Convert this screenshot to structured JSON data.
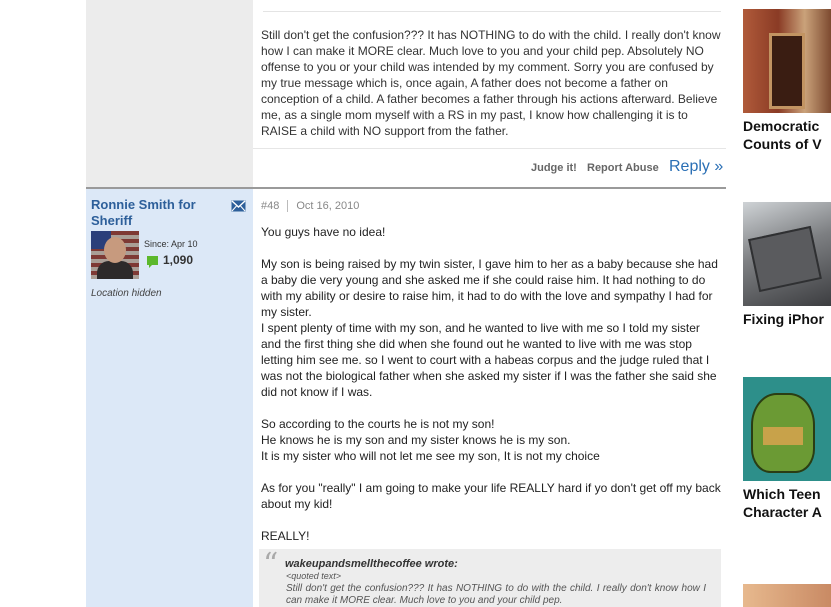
{
  "prev_post": {
    "body": "Still don't get the confusion??? It has NOTHING to do with the child. I really don't know how I can make it MORE clear. Much love to you and your child pep. Absolutely NO offense to you or your child was intended by my comment. Sorry you are confused by my true message which is, once again, A father does not become a father on conception of a child. A father becomes a father through his actions afterward. Believe me, as a single mom myself with a RS in my past, I know how challenging it is to RAISE a child with NO support from the father.",
    "actions": {
      "judge": "Judge it!",
      "report": "Report Abuse",
      "reply": "Reply »"
    }
  },
  "post": {
    "author": "Ronnie Smith for Sheriff",
    "since": "Since: Apr 10",
    "reputation": "1,090",
    "location": "Location hidden",
    "number": "#48",
    "date": "Oct 16, 2010",
    "paragraphs": [
      "You guys have no idea!",
      "My son is being raised by my twin sister, I gave him to her as a baby because she had a baby die very young and she asked me if she could raise him. It had nothing to do with my ability or desire to raise him, it had to do with the love and sympathy I had for my sister.\nI spent plenty of time with my son, and he wanted to live with me so I told my sister and the first thing she did when she found out he wanted to live with me was stop letting him see me. so I went to court with a habeas corpus and the judge ruled that I was not the biological father when she asked my sister if I was the father she said she did not know if I was.",
      "So according to the courts he is not my son!\nHe knows he is my son and my sister knows he is my son.\nIt is my sister who will not let me see my son, It is not my choice",
      "As for you \"really\" I am going to make your life REALLY hard if yo don't get off my back about my kid!",
      "REALLY!"
    ],
    "quote": {
      "author": "wakeupandsmellthecoffee wrote:",
      "label": "<quoted text>",
      "text": "Still don't get the confusion??? It has NOTHING to do with the child. I really don't know how I can make it MORE clear. Much love to you and your child pep."
    }
  },
  "sidebar": {
    "items": [
      {
        "caption": "Democratic\nCounts of V",
        "image": "capitol-building-image"
      },
      {
        "caption": "Fixing iPhor",
        "image": "phone-repair-image"
      },
      {
        "caption": "Which Teen\nCharacter A",
        "image": "ninja-turtle-image"
      },
      {
        "caption": "",
        "image": "portrait-image"
      }
    ]
  },
  "colors": {
    "link": "#2a6fb5",
    "user_panel": "#dce8f7",
    "reputation_icon": "#5cb82c"
  }
}
